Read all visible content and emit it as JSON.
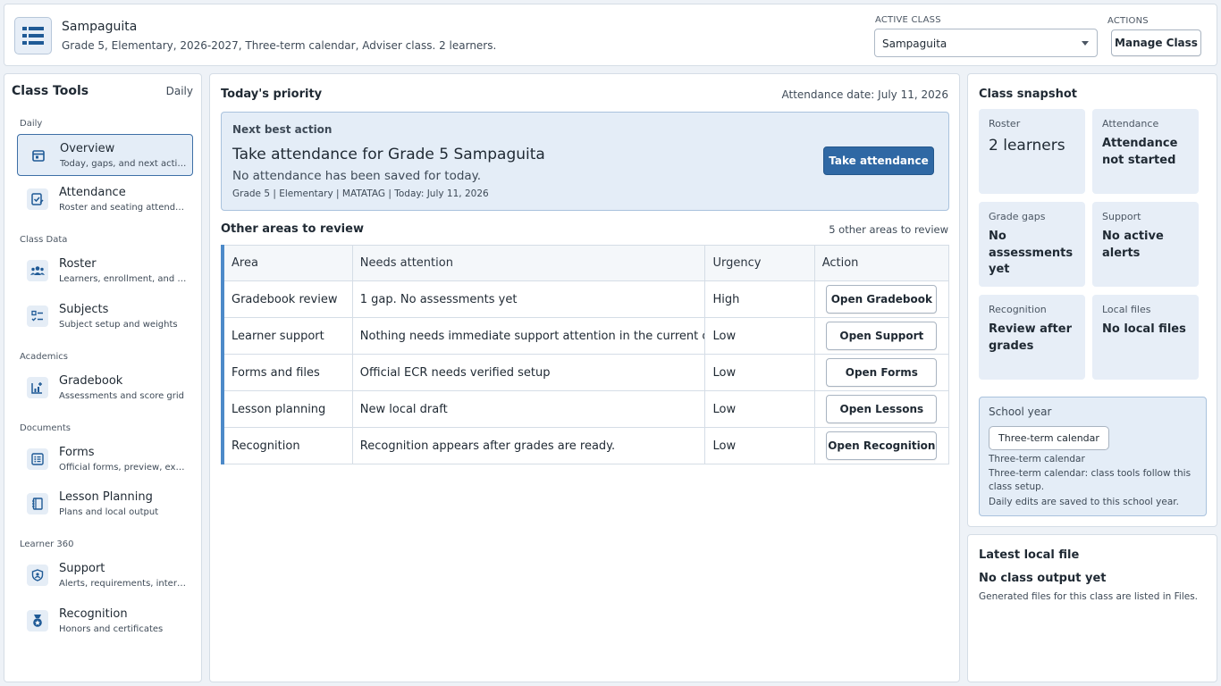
{
  "header": {
    "class_name": "Sampaguita",
    "class_desc": "Grade 5, Elementary, 2026-2027, Three-term calendar, Adviser class. 2 learners.",
    "active_class_label": "ACTIVE CLASS",
    "active_class_value": "Sampaguita",
    "actions_label": "ACTIONS",
    "manage_class_label": "Manage Class"
  },
  "sidebar": {
    "title": "Class Tools",
    "mode": "Daily",
    "groups": [
      "Daily",
      "Class Data",
      "Academics",
      "Documents",
      "Learner 360"
    ],
    "items": [
      {
        "label": "Overview",
        "sub": "Today, gaps, and next actions"
      },
      {
        "label": "Attendance",
        "sub": "Roster and seating attendance"
      },
      {
        "label": "Roster",
        "sub": "Learners, enrollment, and imports"
      },
      {
        "label": "Subjects",
        "sub": "Subject setup and weights"
      },
      {
        "label": "Gradebook",
        "sub": "Assessments and score grid"
      },
      {
        "label": "Forms",
        "sub": "Official forms, preview, export"
      },
      {
        "label": "Lesson Planning",
        "sub": "Plans and local output"
      },
      {
        "label": "Support",
        "sub": "Alerts, requirements, interventions"
      },
      {
        "label": "Recognition",
        "sub": "Honors and certificates"
      }
    ]
  },
  "main": {
    "title": "Today's priority",
    "attendance_date": "Attendance date: July 11, 2026",
    "nba": {
      "kicker": "Next best action",
      "title": "Take attendance for Grade 5 Sampaguita",
      "desc": "No attendance has been saved for today.",
      "meta": "Grade 5 | Elementary | MATATAG | Today: July 11, 2026",
      "button": "Take attendance"
    },
    "other_title": "Other areas to review",
    "other_count": "5 other areas to review",
    "columns": [
      "Area",
      "Needs attention",
      "Urgency",
      "Action"
    ],
    "rows": [
      {
        "area": "Gradebook review",
        "needs": "1 gap. No assessments yet",
        "urgency": "High",
        "action": "Open Gradebook"
      },
      {
        "area": "Learner support",
        "needs": "Nothing needs immediate support attention in the current class.",
        "urgency": "Low",
        "action": "Open Support"
      },
      {
        "area": "Forms and files",
        "needs": "Official ECR needs verified setup",
        "urgency": "Low",
        "action": "Open Forms"
      },
      {
        "area": "Lesson planning",
        "needs": "New local draft",
        "urgency": "Low",
        "action": "Open Lessons"
      },
      {
        "area": "Recognition",
        "needs": "Recognition appears after grades are ready.",
        "urgency": "Low",
        "action": "Open Recognition"
      }
    ]
  },
  "snapshot": {
    "title": "Class snapshot",
    "tiles": [
      {
        "label": "Roster",
        "value": "2 learners"
      },
      {
        "label": "Attendance",
        "value": "Attendance not started"
      },
      {
        "label": "Grade gaps",
        "value": "No assessments yet"
      },
      {
        "label": "Support",
        "value": "No active alerts"
      },
      {
        "label": "Recognition",
        "value": "Review after grades"
      },
      {
        "label": "Local files",
        "value": "No local files"
      }
    ],
    "school_year": {
      "label": "School year",
      "chip": "Three-term calendar",
      "line1": "Three-term calendar",
      "line2": "Three-term calendar: class tools follow this class setup.",
      "line3": "Daily edits are saved to this school year."
    }
  },
  "latest": {
    "title": "Latest local file",
    "heading": "No class output yet",
    "desc": "Generated files for this class are listed in Files."
  },
  "colors": {
    "accent": "#2f68a4",
    "accent_light": "#e4edf7",
    "table_stripe": "#4d8ac9"
  }
}
